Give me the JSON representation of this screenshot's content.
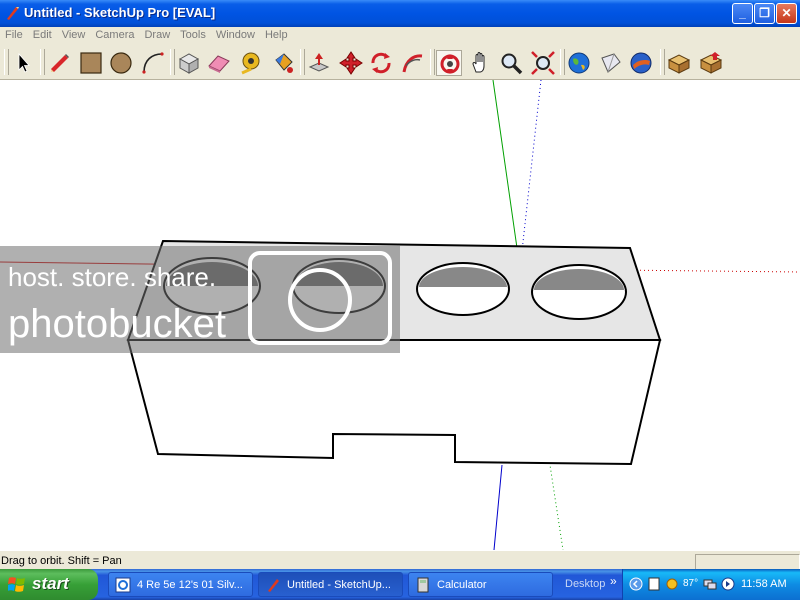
{
  "window": {
    "title": "Untitled - SketchUp Pro [EVAL]",
    "minimize_glyph": "_",
    "maximize_glyph": "❐",
    "close_glyph": "✕"
  },
  "menu": [
    "File",
    "Edit",
    "View",
    "Camera",
    "Draw",
    "Tools",
    "Window",
    "Help"
  ],
  "toolbar": {
    "tools": [
      "select",
      "pencil",
      "rectangle",
      "circle",
      "arc",
      "make-component",
      "eraser",
      "tape-measure",
      "paint-bucket",
      "push-pull",
      "move",
      "rotate",
      "follow-me",
      "orbit",
      "pan",
      "zoom",
      "zoom-extents",
      "get-models",
      "share-model",
      "google-earth",
      "components-warehouse",
      "upload-component"
    ]
  },
  "viewport": {
    "watermark_line1": "host. store. share.",
    "watermark_line2": "photobucket",
    "axis_colors": {
      "red": "#CC0000",
      "green": "#00A000",
      "blue": "#0000CC"
    }
  },
  "status": {
    "hint": "Drag to orbit.  Shift = Pan"
  },
  "taskbar": {
    "start_label": "start",
    "tasks": [
      {
        "label": "4 Re 5e 12's 01 Silv...",
        "active": false
      },
      {
        "label": "Untitled - SketchUp...",
        "active": true
      },
      {
        "label": "Calculator",
        "active": false
      }
    ],
    "desktop_label": "Desktop",
    "temperature": "87°",
    "clock": "11:58 AM"
  }
}
